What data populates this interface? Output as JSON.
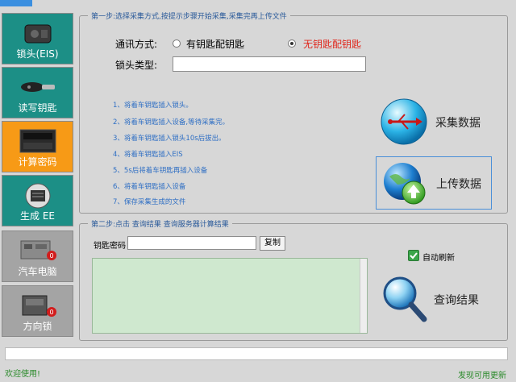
{
  "sidebar": {
    "items": [
      {
        "label": "锁头(EIS)"
      },
      {
        "label": "读写钥匙"
      },
      {
        "label": "计算密码"
      },
      {
        "label": "生成 EE"
      },
      {
        "label": "汽车电脑"
      },
      {
        "label": "方向锁"
      }
    ]
  },
  "step1": {
    "title": "第一步:选择采集方式,按提示步骤开始采集,采集完再上传文件",
    "comm_label": "通讯方式:",
    "opt_with_key": "有钥匙配钥匙",
    "opt_no_key": "无钥匙配钥匙",
    "lock_type_label": "锁头类型:",
    "lock_type_value": "",
    "instructions": [
      "1、将着车钥匙插入锁头。",
      "2、将着车钥匙插入设备,等待采集完。",
      "3、将着车钥匙插入锁头10s后拔出。",
      "4、将着车钥匙插入EIS",
      "5、5s后将着车钥匙再插入设备",
      "6、将着车钥匙插入设备",
      "7、保存采集生成的文件"
    ],
    "collect_label": "采集数据",
    "upload_label": "上传数据"
  },
  "step2": {
    "title": "第二步:点击 查询结果 查询服务器计算结果",
    "key_pwd_label": "钥匙密码",
    "key_pwd_value": "",
    "copy_label": "复制",
    "auto_refresh_label": "自动刷新",
    "query_label": "查询结果",
    "result_text": ""
  },
  "statusbar": {
    "welcome": "欢迎使用!",
    "update": "发现可用更新"
  },
  "colors": {
    "teal": "#1c8f86",
    "orange": "#f79a16",
    "accent_red": "#e0261b",
    "link_blue": "#2f6fc4"
  }
}
